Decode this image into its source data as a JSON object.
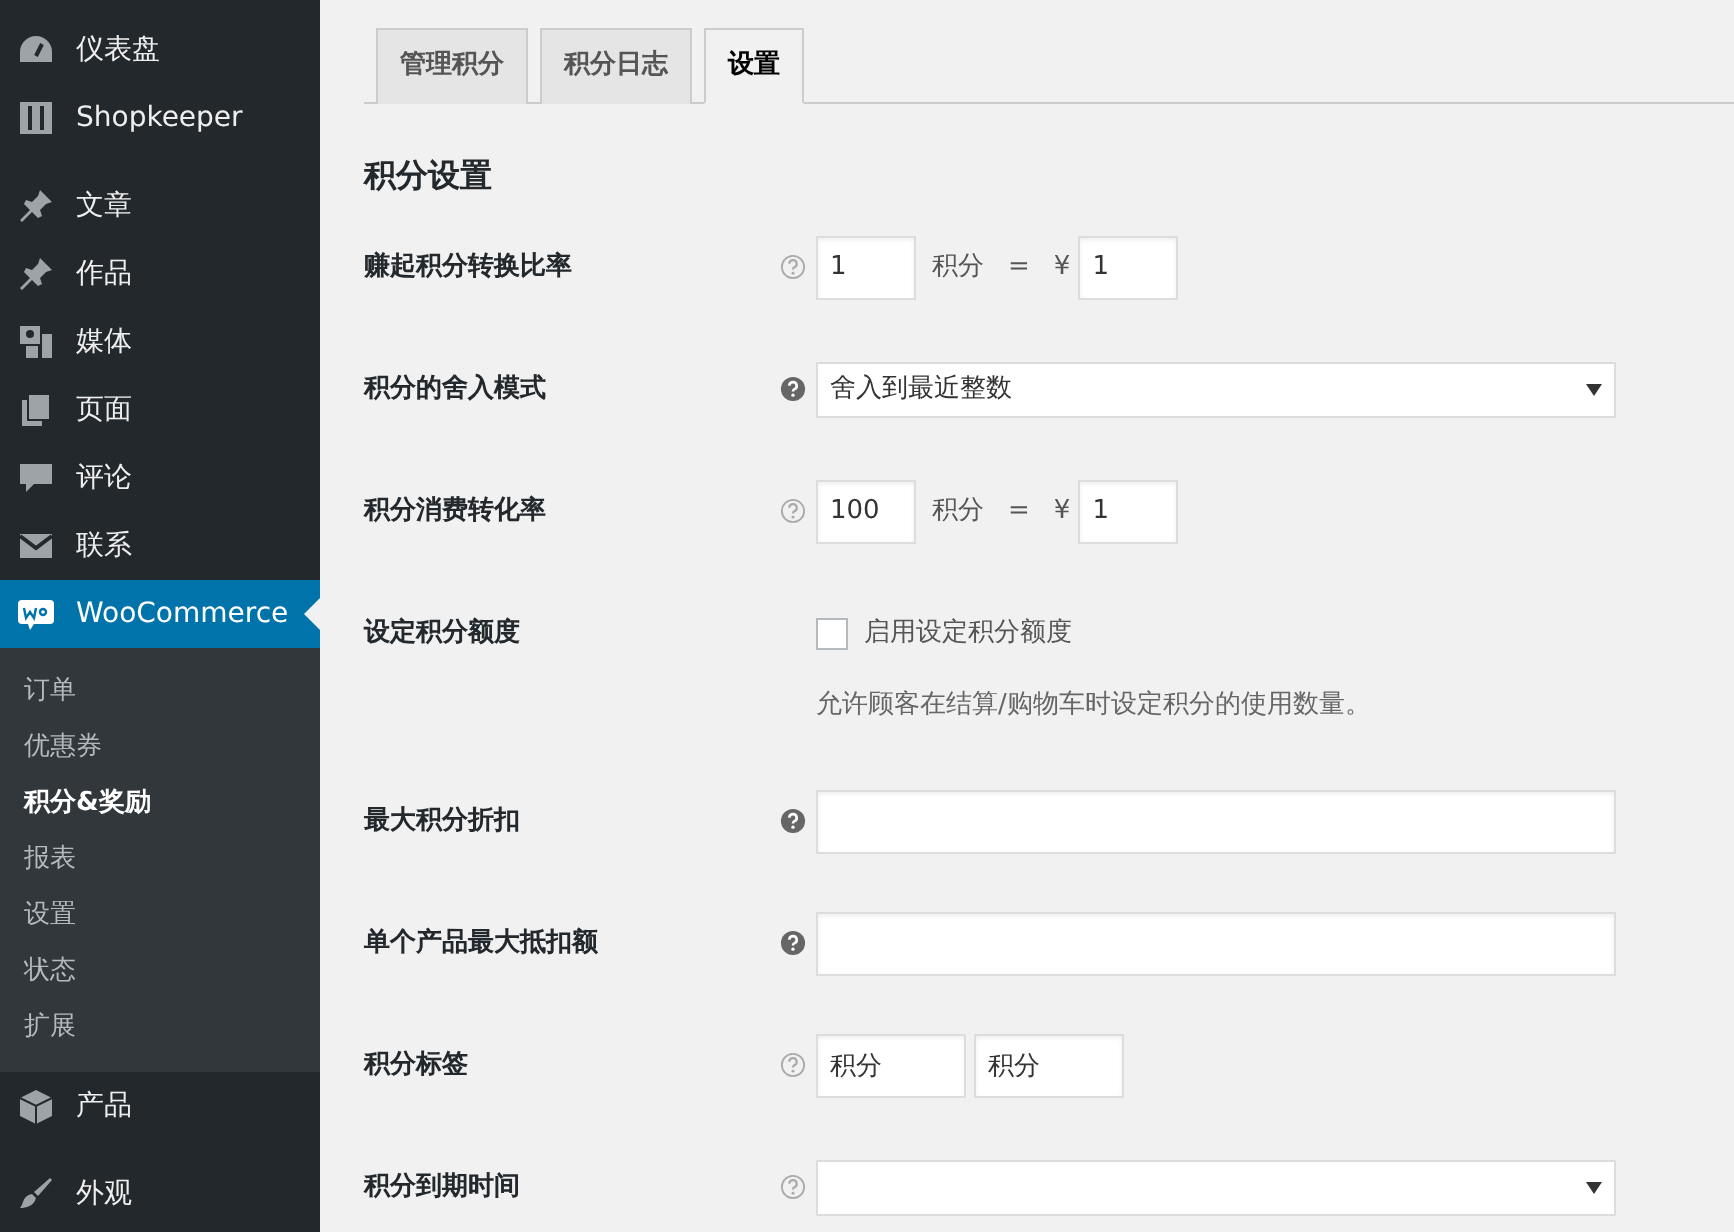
{
  "sidebar": {
    "groups": [
      {
        "items": [
          {
            "label": "仪表盘",
            "selected": false
          },
          {
            "label": "Shopkeeper",
            "selected": false
          }
        ]
      },
      {
        "items": [
          {
            "label": "文章",
            "selected": false
          },
          {
            "label": "作品",
            "selected": false
          },
          {
            "label": "媒体",
            "selected": false
          },
          {
            "label": "页面",
            "selected": false
          },
          {
            "label": "评论",
            "selected": false
          },
          {
            "label": "联系",
            "selected": false
          },
          {
            "label": "WooCommerce",
            "selected": true,
            "children": [
              {
                "label": "订单",
                "selected": false
              },
              {
                "label": "优惠券",
                "selected": false
              },
              {
                "label": "积分&奖励",
                "selected": true
              },
              {
                "label": "报表",
                "selected": false
              },
              {
                "label": "设置",
                "selected": false
              },
              {
                "label": "状态",
                "selected": false
              },
              {
                "label": "扩展",
                "selected": false
              }
            ]
          },
          {
            "label": "产品",
            "selected": false
          }
        ]
      },
      {
        "items": [
          {
            "label": "外观",
            "selected": false
          }
        ]
      }
    ]
  },
  "tabs": [
    {
      "label": "管理积分",
      "selected": false
    },
    {
      "label": "积分日志",
      "selected": false
    },
    {
      "label": "设置",
      "selected": true
    }
  ],
  "section_title": "积分设置",
  "settings": [
    {
      "kind": "ratio",
      "label": "赚起积分转换比率",
      "help_filled": false,
      "points": "1",
      "unit": "积分",
      "equals": "=",
      "currency": "¥",
      "amount": "1"
    },
    {
      "kind": "select",
      "label": "积分的舍入模式",
      "help_filled": true,
      "value": "舍入到最近整数"
    },
    {
      "kind": "ratio",
      "label": "积分消费转化率",
      "help_filled": false,
      "points": "100",
      "unit": "积分",
      "equals": "=",
      "currency": "¥",
      "amount": "1"
    },
    {
      "kind": "checkbox",
      "label": "设定积分额度",
      "checked": false,
      "checkbox_label": "启用设定积分额度",
      "description": "允许顾客在结算/购物车时设定积分的使用数量。"
    },
    {
      "kind": "text",
      "label": "最大积分折扣",
      "help_filled": true
    },
    {
      "kind": "text",
      "label": "单个产品最大抵扣额",
      "help_filled": true
    },
    {
      "kind": "labels",
      "label": "积分标签",
      "help_filled": false,
      "values": [
        "积分",
        "积分"
      ]
    },
    {
      "kind": "select",
      "label": "积分到期时间",
      "help_filled": false
    }
  ]
}
